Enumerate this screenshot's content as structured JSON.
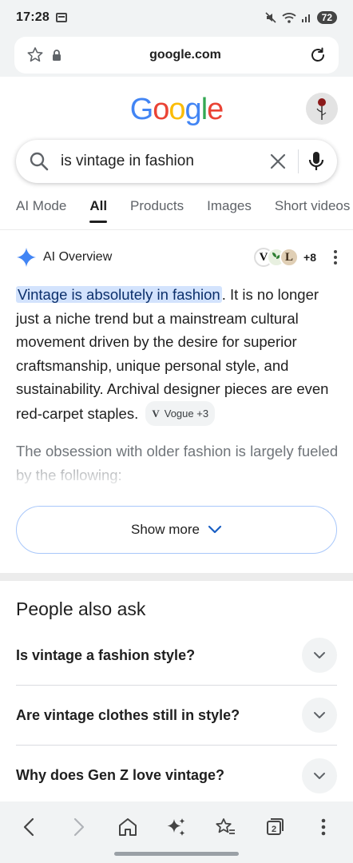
{
  "status_bar": {
    "time": "17:28",
    "battery": "72"
  },
  "browser": {
    "url": "google.com"
  },
  "google": {
    "logo_letters": [
      "G",
      "o",
      "o",
      "g",
      "l",
      "e"
    ],
    "search_query": "is vintage in fashion",
    "tabs": [
      {
        "label": "AI Mode",
        "active": false
      },
      {
        "label": "All",
        "active": true
      },
      {
        "label": "Products",
        "active": false
      },
      {
        "label": "Images",
        "active": false
      },
      {
        "label": "Short videos",
        "active": false
      }
    ]
  },
  "ai_overview": {
    "title": "AI Overview",
    "sources": {
      "avatars": [
        "V",
        "",
        "L"
      ],
      "more": "+8"
    },
    "highlight": "Vintage is absolutely in fashion",
    "body": ". It is no longer just a niche trend but a mainstream cultural movement driven by the desire for superior craftsmanship, unique personal style, and sustainability. Archival designer pieces are even red-carpet staples.",
    "citation": {
      "icon": "V",
      "label": "Vogue +3"
    },
    "fade_text": "The obsession with older fashion is largely fueled by the following:",
    "show_more": "Show more"
  },
  "people_also_ask": {
    "title": "People also ask",
    "questions": [
      "Is vintage a fashion style?",
      "Are vintage clothes still in style?",
      "Why does Gen Z love vintage?"
    ]
  },
  "bottom_nav": {
    "tab_count": "2",
    "icons": [
      "back-icon",
      "forward-icon",
      "home-icon",
      "sparkle-icon",
      "bookmark-star-icon",
      "tabs-icon",
      "menu-icon"
    ]
  },
  "colors": {
    "accent_blue": "#4285f4",
    "highlight_bg": "#d3e3fd",
    "show_more_border": "#a8c7fa",
    "chrome_bg": "#f1f3f4"
  }
}
